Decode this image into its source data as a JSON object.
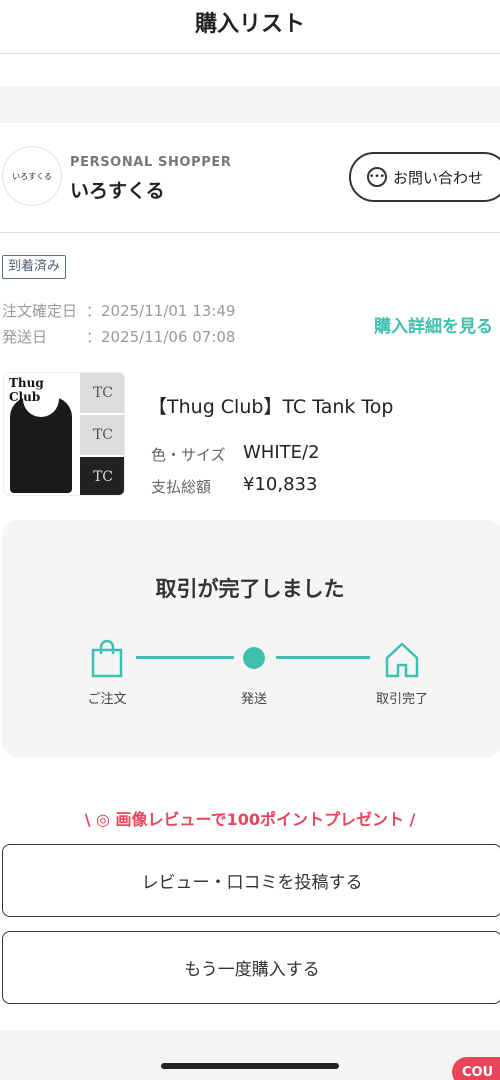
{
  "header": {
    "title": "購入リスト"
  },
  "shop": {
    "avatar_text": "いろすくる",
    "type_label": "PERSONAL SHOPPER",
    "name": "いろすくる",
    "contact_label": "お問い合わせ"
  },
  "order": {
    "status_badge": "到着済み",
    "confirmed_label": "注文確定日",
    "confirmed_value": "：2025/11/01 13:49",
    "shipped_label": "発送日",
    "shipped_value": "：2025/11/06 07:08",
    "detail_link": "購入詳細を見る"
  },
  "product": {
    "image_brand_text": "Thug Club",
    "thumb_text": "TC",
    "title": "【Thug Club】TC Tank Top",
    "color_size_label": "色・サイズ",
    "color_size_value": "WHITE/2",
    "total_label": "支払総額",
    "total_value": "¥10,833"
  },
  "status": {
    "title": "取引が完了しました",
    "steps": [
      {
        "label": "ご注文"
      },
      {
        "label": "発送"
      },
      {
        "label": "取引完了"
      }
    ],
    "accent_color": "#3fbfb0"
  },
  "promo": {
    "text": "\\ ◎ 画像レビューで100ポイントプレゼント /",
    "color": "#e8445a"
  },
  "actions": {
    "review_label": "レビュー・口コミを投稿する",
    "rebuy_label": "もう一度購入する"
  },
  "coupon": {
    "label": "COU"
  }
}
